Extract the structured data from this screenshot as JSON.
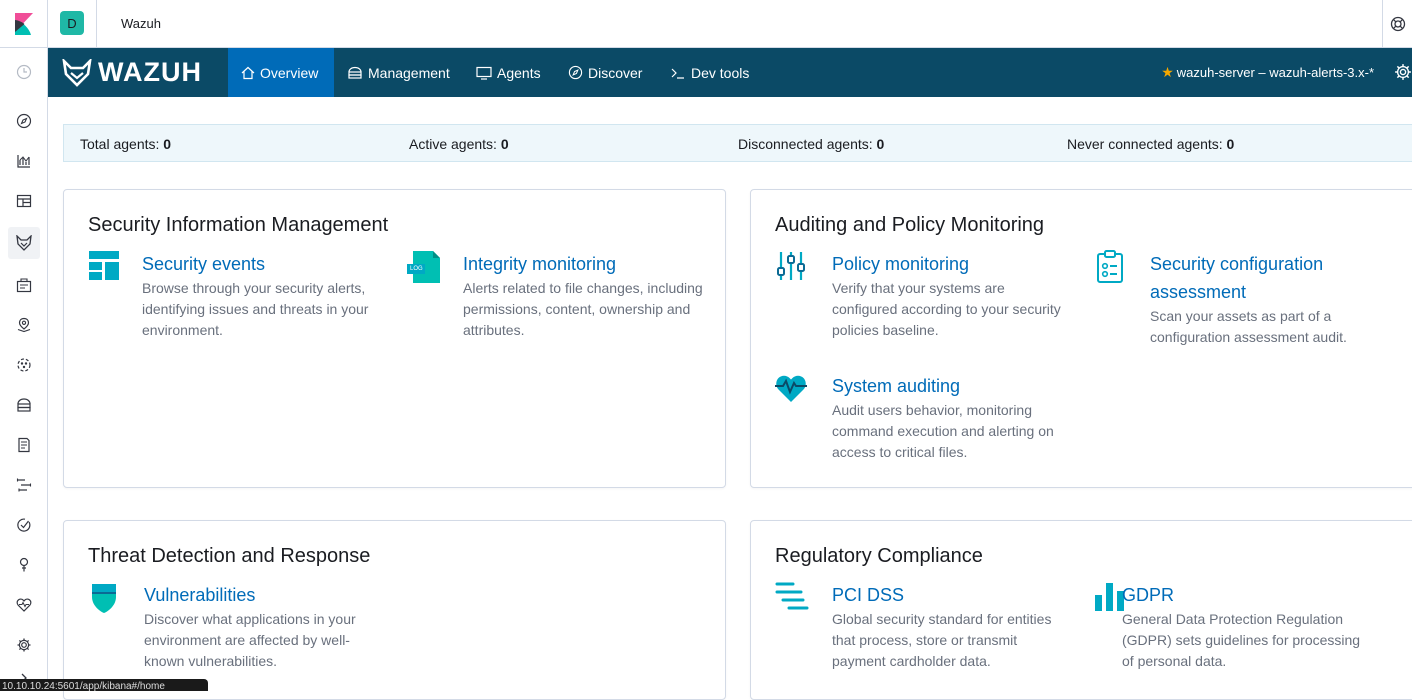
{
  "header": {
    "space_initial": "D",
    "app_title": "Wazuh"
  },
  "siderail": {
    "items": [
      "clock-icon",
      "compass-icon",
      "visualize-icon",
      "dashboard-icon",
      "wazuh-icon",
      "canvas-icon",
      "maps-icon",
      "ml-icon",
      "infrastructure-icon",
      "logs-icon",
      "apm-icon",
      "uptime-icon",
      "dev-tools-icon",
      "monitoring-icon",
      "management-icon",
      "collapse-icon"
    ]
  },
  "nav": {
    "logo_text": "WAZUH",
    "tabs": [
      {
        "label": "Overview",
        "icon": "home-icon",
        "active": true
      },
      {
        "label": "Management",
        "icon": "cloud-icon",
        "active": false
      },
      {
        "label": "Agents",
        "icon": "monitor-icon",
        "active": false
      },
      {
        "label": "Discover",
        "icon": "compass-icon",
        "active": false
      },
      {
        "label": "Dev tools",
        "icon": "terminal-icon",
        "active": false
      }
    ],
    "api_selector": "wazuh-server – wazuh-alerts-3.x-*"
  },
  "stats": {
    "total_label": "Total agents: ",
    "total_value": "0",
    "active_label": "Active agents: ",
    "active_value": "0",
    "disconnected_label": "Disconnected agents: ",
    "disconnected_value": "0",
    "never_label": "Never connected agents: ",
    "never_value": "0"
  },
  "panels": {
    "sim": {
      "title": "Security Information Management",
      "security_events": {
        "title": "Security events",
        "desc": "Browse through your security alerts, identifying issues and threats in your environment."
      },
      "integrity": {
        "title": "Integrity monitoring",
        "desc": "Alerts related to file changes, including permissions, content, ownership and attributes.",
        "icon_text": "LOG"
      }
    },
    "apm": {
      "title": "Auditing and Policy Monitoring",
      "policy": {
        "title": "Policy monitoring",
        "desc": "Verify that your systems are configured according to your security policies baseline."
      },
      "sca": {
        "title": "Security configuration assessment",
        "desc": "Scan your assets as part of a configuration assessment audit."
      },
      "audit": {
        "title": "System auditing",
        "desc": "Audit users behavior, monitoring command execution and alerting on access to critical files."
      }
    },
    "tdr": {
      "title": "Threat Detection and Response",
      "vuln": {
        "title": "Vulnerabilities",
        "desc": "Discover what applications in your environment are affected by well-known vulnerabilities."
      }
    },
    "rc": {
      "title": "Regulatory Compliance",
      "pci": {
        "title": "PCI DSS",
        "desc": "Global security standard for entities that process, store or transmit payment cardholder data."
      },
      "gdpr": {
        "title": "GDPR",
        "desc": "General Data Protection Regulation (GDPR) sets guidelines for processing of personal data."
      }
    }
  },
  "status_url": "10.10.10.24:5601/app/kibana#/home",
  "colors": {
    "nav_bg": "#0b4a66",
    "nav_active": "#006bb8",
    "link": "#006bb8",
    "accent_teal": "#00a9c4",
    "badge": "#1fb8a6"
  }
}
